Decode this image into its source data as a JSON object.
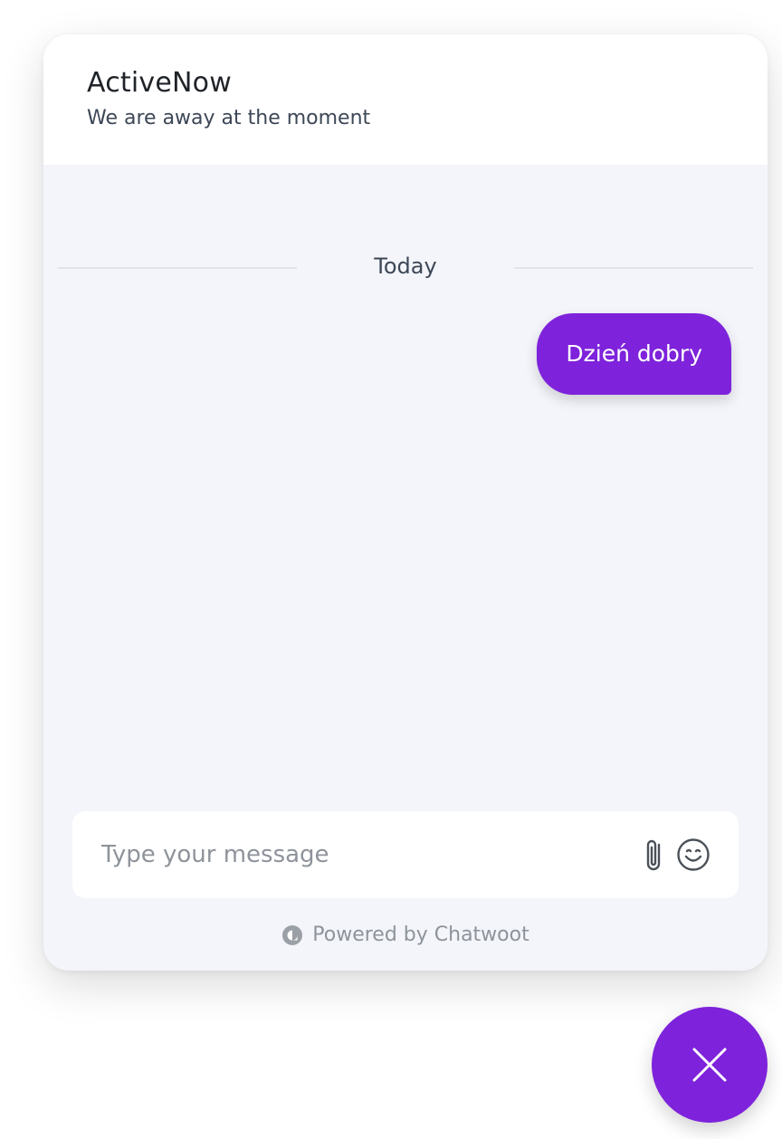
{
  "header": {
    "title": "ActiveNow",
    "subtitle": "We are away at the moment"
  },
  "conversation": {
    "date_divider": "Today",
    "messages": [
      {
        "text": "Dzień dobry",
        "direction": "outgoing"
      }
    ]
  },
  "composer": {
    "placeholder": "Type your message",
    "value": "",
    "attach_icon": "paperclip-icon",
    "emoji_icon": "emoji-icon"
  },
  "branding": {
    "text": "Powered by Chatwoot",
    "logo_icon": "chatwoot-logo-icon"
  },
  "launcher": {
    "icon": "close-icon"
  },
  "colors": {
    "accent": "#7e22db",
    "panel_background": "#f3f5fa",
    "header_background": "#ffffff"
  }
}
